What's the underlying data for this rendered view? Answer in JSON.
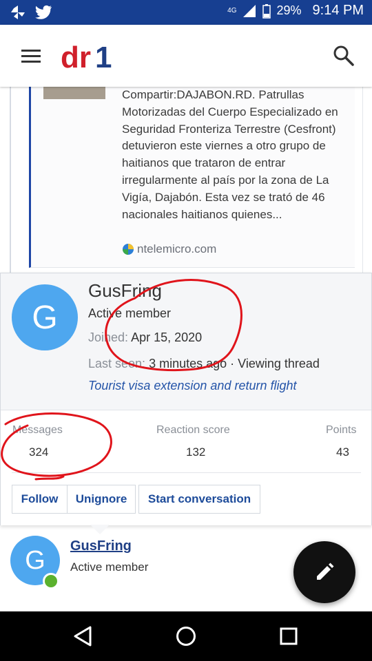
{
  "status_bar": {
    "battery": "29%",
    "time": "9:14 PM",
    "network": "4G",
    "icons": [
      "pinwheel-icon",
      "twitter-icon",
      "signal-icon",
      "battery-icon"
    ]
  },
  "header": {
    "logo_text": "dr1",
    "menu_icon": "hamburger-icon",
    "search_icon": "search-icon"
  },
  "quoted_article": {
    "text": "Compartir:DAJABON.RD. Patrullas Motorizadas del Cuerpo Especializado en Seguridad Fronteriza Terrestre (Cesfront) detuvieron este viernes a otro grupo de haitianos que trataron de entrar irregularmente al país por la zona de La Vigía, Dajabón. Esta vez se trató de 46 nacionales haitianos quienes...",
    "source": "ntelemicro.com"
  },
  "member_card": {
    "avatar_letter": "G",
    "username": "GusFring",
    "status": "Active member",
    "joined_label": "Joined:",
    "joined_value": "Apr 15, 2020",
    "last_seen_label": "Last seen:",
    "last_seen_value": "3 minutes ago · Viewing thread",
    "thread_title": "Tourist visa extension and return flight",
    "stats": {
      "messages_label": "Messages",
      "messages_value": "324",
      "reaction_label": "Reaction score",
      "reaction_value": "132",
      "points_label": "Points",
      "points_value": "43"
    },
    "buttons": {
      "follow": "Follow",
      "unignore": "Unignore",
      "start_conversation": "Start conversation"
    }
  },
  "post_author": {
    "avatar_letter": "G",
    "name": "GusFring",
    "role": "Active member"
  },
  "fab_icon": "pencil-icon",
  "colors": {
    "status_bar": "#173f91",
    "accent_blue": "#1d4b9a",
    "avatar_blue": "#4ea7ef",
    "online_green": "#5bb12e",
    "annotation_red": "#e0141b"
  }
}
